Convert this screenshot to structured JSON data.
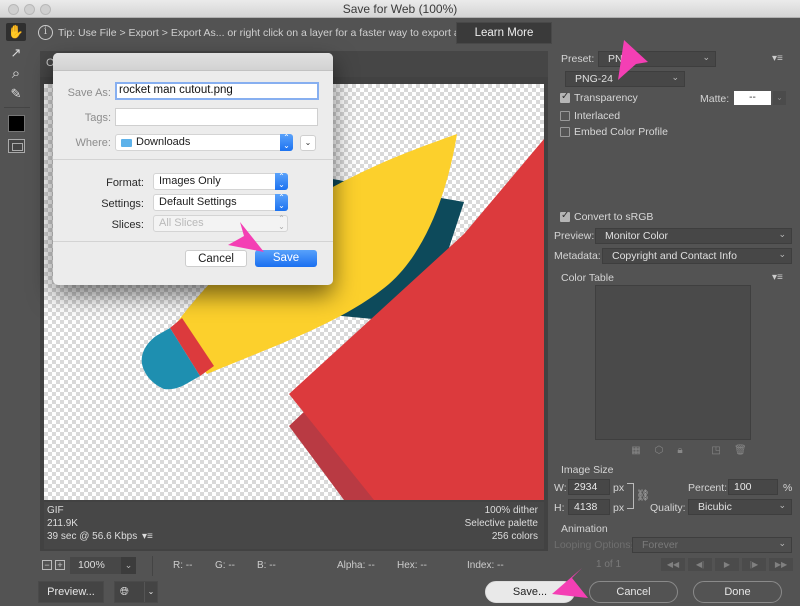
{
  "window": {
    "title": "Save for Web (100%)"
  },
  "tip": {
    "icon": "info-icon",
    "text": "Tip: Use File > Export > Export As...  or right click on a layer for a faster way to export assets",
    "learn_more": "Learn More"
  },
  "tools": [
    {
      "name": "hand-tool",
      "icon": "hand-icon",
      "glyph": "✋"
    },
    {
      "name": "slice-select-tool",
      "icon": "slice-select-icon",
      "glyph": "↗"
    },
    {
      "name": "zoom-tool",
      "icon": "magnifier-icon",
      "glyph": "⌕"
    },
    {
      "name": "eyedropper-tool",
      "icon": "eyedropper-icon",
      "glyph": "✎"
    }
  ],
  "preview": {
    "tab_label": "O",
    "info_left": [
      "GIF",
      "211.9K",
      "39 sec @ 56.6 Kbps"
    ],
    "info_right": [
      "100% dither",
      "Selective palette",
      "256 colors"
    ],
    "info_menu_icon": "▾≡",
    "art_colors": {
      "yellow": "#fcd02c",
      "teal": "#0d4a5b",
      "red": "#dc3a3d",
      "dark_red": "#b93a43",
      "blue": "#1e8fb0"
    }
  },
  "status": {
    "zoom_out": "−",
    "zoom_in": "+",
    "zoom": "100%",
    "r": "R: --",
    "g": "G: --",
    "b": "B: --",
    "alpha": "Alpha: --",
    "hex": "Hex: --",
    "index": "Index: --"
  },
  "settings": {
    "preset_label": "Preset:",
    "preset_value": "PNG-24",
    "preset_value_visible": "PN",
    "format_value": "PNG-24",
    "transparency": {
      "label": "Transparency",
      "checked": true
    },
    "matte_label": "Matte:",
    "matte_value": "--",
    "interlaced": {
      "label": "Interlaced",
      "checked": false
    },
    "embed_profile": {
      "label": "Embed Color Profile",
      "checked": false
    },
    "convert_srgb": {
      "label": "Convert to sRGB",
      "checked": true
    },
    "preview_label": "Preview:",
    "preview_value": "Monitor Color",
    "metadata_label": "Metadata:",
    "metadata_value": "Copyright and Contact Info",
    "color_table_label": "Color Table",
    "color_table_icons": [
      "transparency-map-icon",
      "web-shift-icon",
      "lock-icon",
      "new-color-icon",
      "trash-icon"
    ],
    "image_size_label": "Image Size",
    "width_label": "W:",
    "width_value": "2934",
    "height_label": "H:",
    "height_value": "4138",
    "unit": "px",
    "percent_label": "Percent:",
    "percent_value": "100",
    "percent_unit": "%",
    "quality_label": "Quality:",
    "quality_value": "Bicubic",
    "animation_label": "Animation",
    "looping_label": "Looping Options:",
    "looping_value": "Forever",
    "frame_counter": "1 of 1"
  },
  "bottom": {
    "preview_btn": "Preview...",
    "save_btn": "Save...",
    "cancel_btn": "Cancel",
    "done_btn": "Done"
  },
  "dialog": {
    "save_as_label": "Save As:",
    "save_as_value": "rocket man cutout.png",
    "tags_label": "Tags:",
    "tags_value": "",
    "where_label": "Where:",
    "where_value": "Downloads",
    "format_label": "Format:",
    "format_value": "Images Only",
    "settings_label": "Settings:",
    "settings_value": "Default Settings",
    "slices_label": "Slices:",
    "slices_value": "All Slices",
    "cancel": "Cancel",
    "save": "Save"
  },
  "annotation_color": "#f43fb4"
}
